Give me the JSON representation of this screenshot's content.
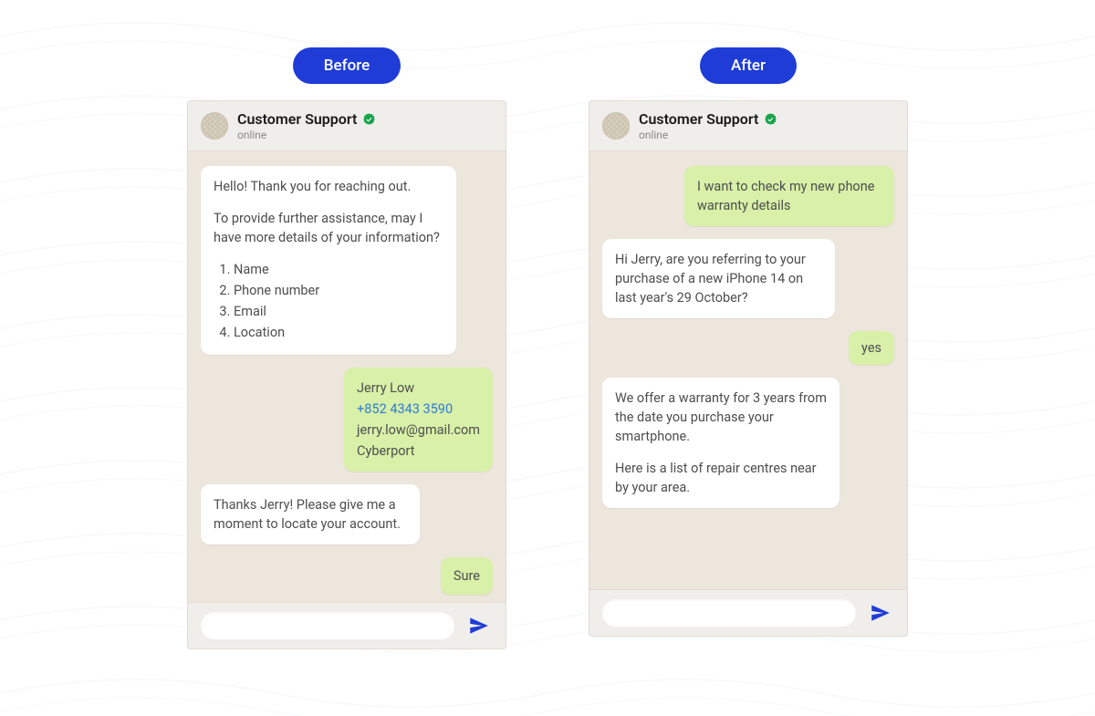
{
  "labels": {
    "before": "Before",
    "after": "After"
  },
  "chat_header": {
    "title": "Customer Support",
    "status": "online"
  },
  "before_chat": {
    "msg1_p1": "Hello! Thank you for reaching out.",
    "msg1_p2": "To provide further assistance, may I have more details of your information?",
    "msg1_li1": "Name",
    "msg1_li2": "Phone number",
    "msg1_li3": "Email",
    "msg1_li4": "Location",
    "msg2_line1": "Jerry Low",
    "msg2_line2": "+852 4343 3590",
    "msg2_line3": "jerry.low@gmail.com",
    "msg2_line4": "Cyberport",
    "msg3": "Thanks Jerry! Please give me a moment to locate your account.",
    "msg4": "Sure"
  },
  "after_chat": {
    "msg1": "I want to check my new phone warranty details",
    "msg2": "Hi Jerry, are you referring to your purchase of a new iPhone 14 on last year's 29 October?",
    "msg3": "yes",
    "msg4_p1": "We offer a warranty for 3 years from the date you purchase your smartphone.",
    "msg4_p2": "Here is a list of repair centres near by your area."
  },
  "input": {
    "placeholder": ""
  }
}
